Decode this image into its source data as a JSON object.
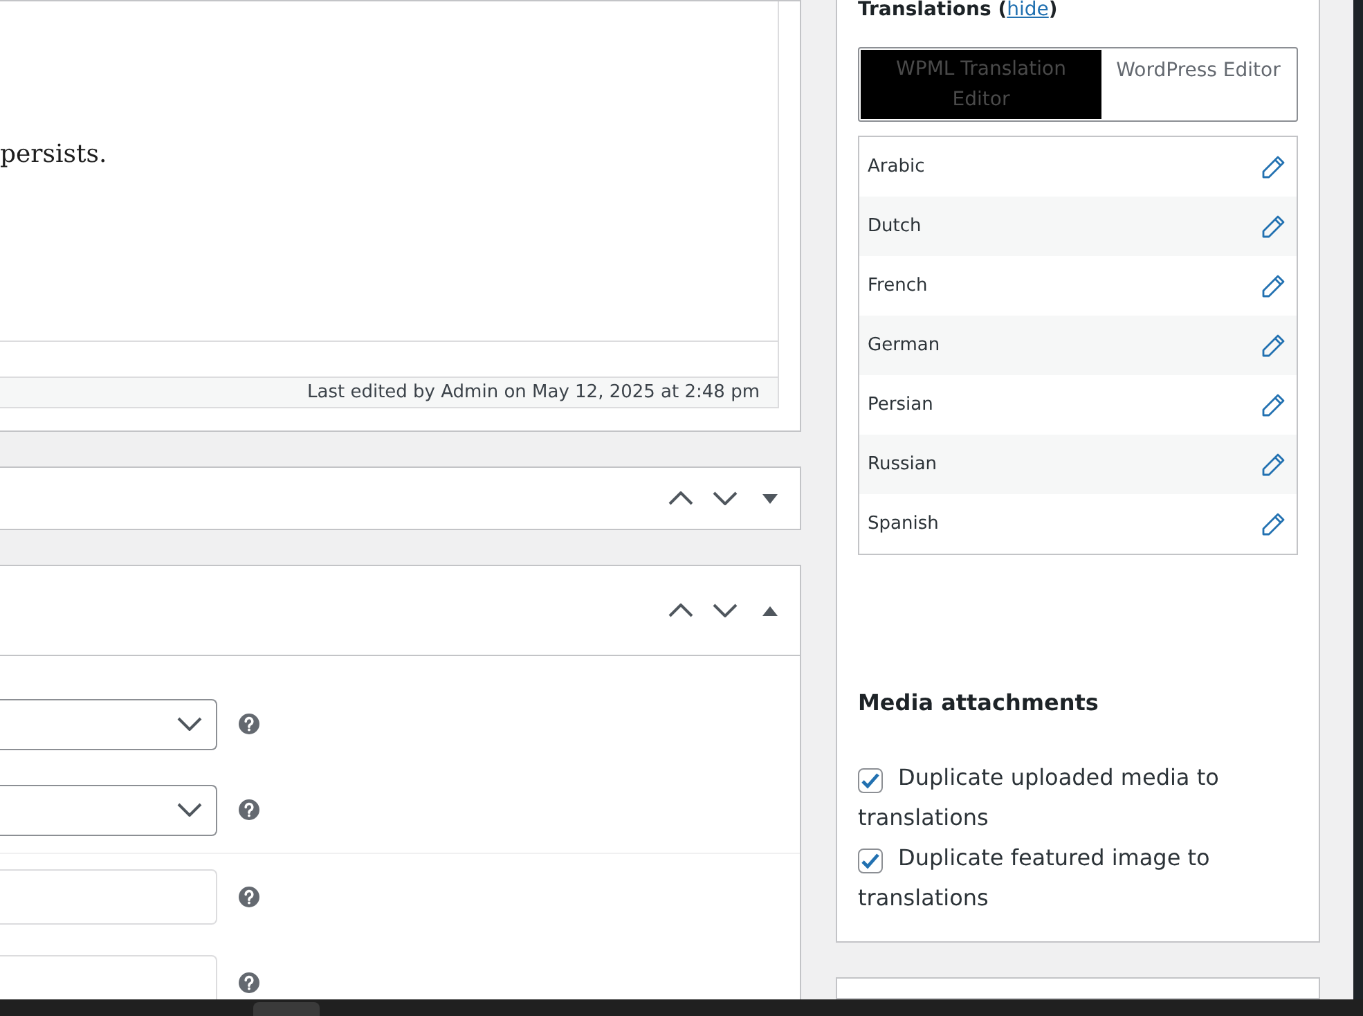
{
  "editor": {
    "text": "persists.",
    "last_edited": "Last edited by Admin on May 12, 2025 at 2:48 pm"
  },
  "boxes": [
    {
      "expanded": false
    },
    {
      "expanded": true,
      "fields": [
        {
          "kind": "select"
        },
        {
          "kind": "select"
        },
        {
          "kind": "input"
        },
        {
          "kind": "input"
        }
      ]
    }
  ],
  "translations": {
    "title": "Translations",
    "link_before": "(",
    "link": "hide",
    "link_after": ")",
    "editor_tabs": [
      {
        "label": "WPML Translation Editor",
        "selected": true
      },
      {
        "label": "WordPress Editor",
        "selected": false
      }
    ],
    "languages": [
      "Arabic",
      "Dutch",
      "French",
      "German",
      "Persian",
      "Russian",
      "Spanish"
    ]
  },
  "media": {
    "title": "Media attachments",
    "options": [
      {
        "label": "Duplicate uploaded media to translations",
        "checked": true
      },
      {
        "label": "Duplicate featured image to translations",
        "checked": true
      }
    ]
  }
}
